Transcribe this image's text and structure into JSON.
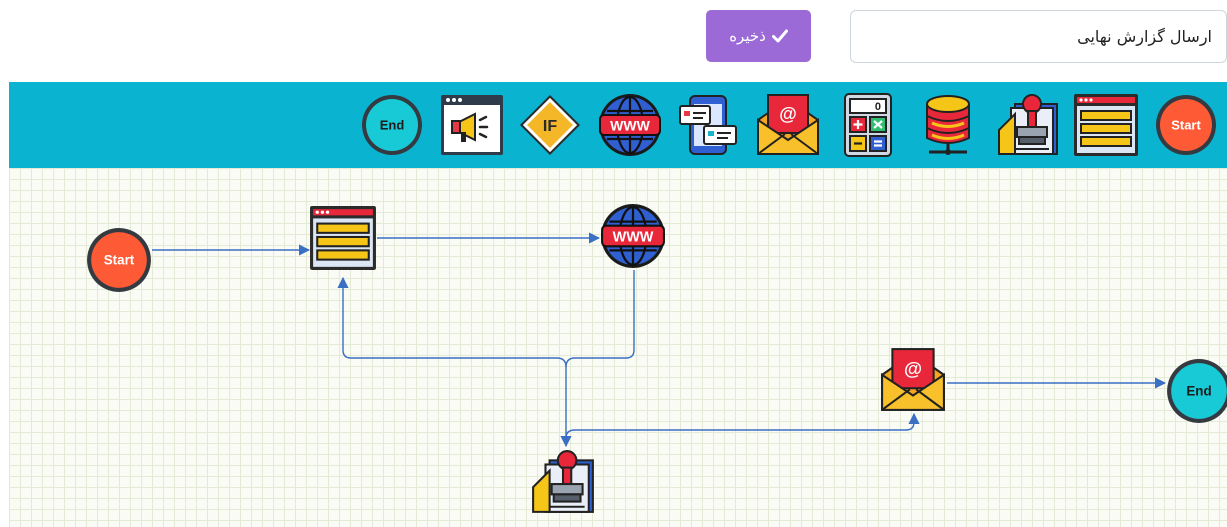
{
  "header": {
    "title_value": "ارسال گزارش نهایی",
    "save_label": "ذخیره"
  },
  "toolbar": {
    "tools": [
      {
        "icon": "start-circle-icon",
        "label": "Start"
      },
      {
        "icon": "form-icon"
      },
      {
        "icon": "stamp-icon"
      },
      {
        "icon": "database-icon"
      },
      {
        "icon": "calculator-icon"
      },
      {
        "icon": "email-icon"
      },
      {
        "icon": "sms-icon"
      },
      {
        "icon": "web-service-icon"
      },
      {
        "icon": "condition-icon",
        "label": "IF"
      },
      {
        "icon": "announcement-icon"
      },
      {
        "icon": "end-circle-icon",
        "label": "End"
      }
    ]
  },
  "canvas": {
    "nodes": [
      {
        "icon": "start-circle-icon",
        "label": "Start"
      },
      {
        "icon": "form-icon"
      },
      {
        "icon": "web-service-icon"
      },
      {
        "icon": "stamp-icon"
      },
      {
        "icon": "email-icon"
      },
      {
        "icon": "end-circle-icon",
        "label": "End"
      }
    ]
  },
  "colors": {
    "toolbar_bg": "#0ab3cf",
    "save_button": "#9b6ad6",
    "start": "#ff5a36",
    "end": "#18c9d6",
    "connector": "#3a6fc4"
  }
}
